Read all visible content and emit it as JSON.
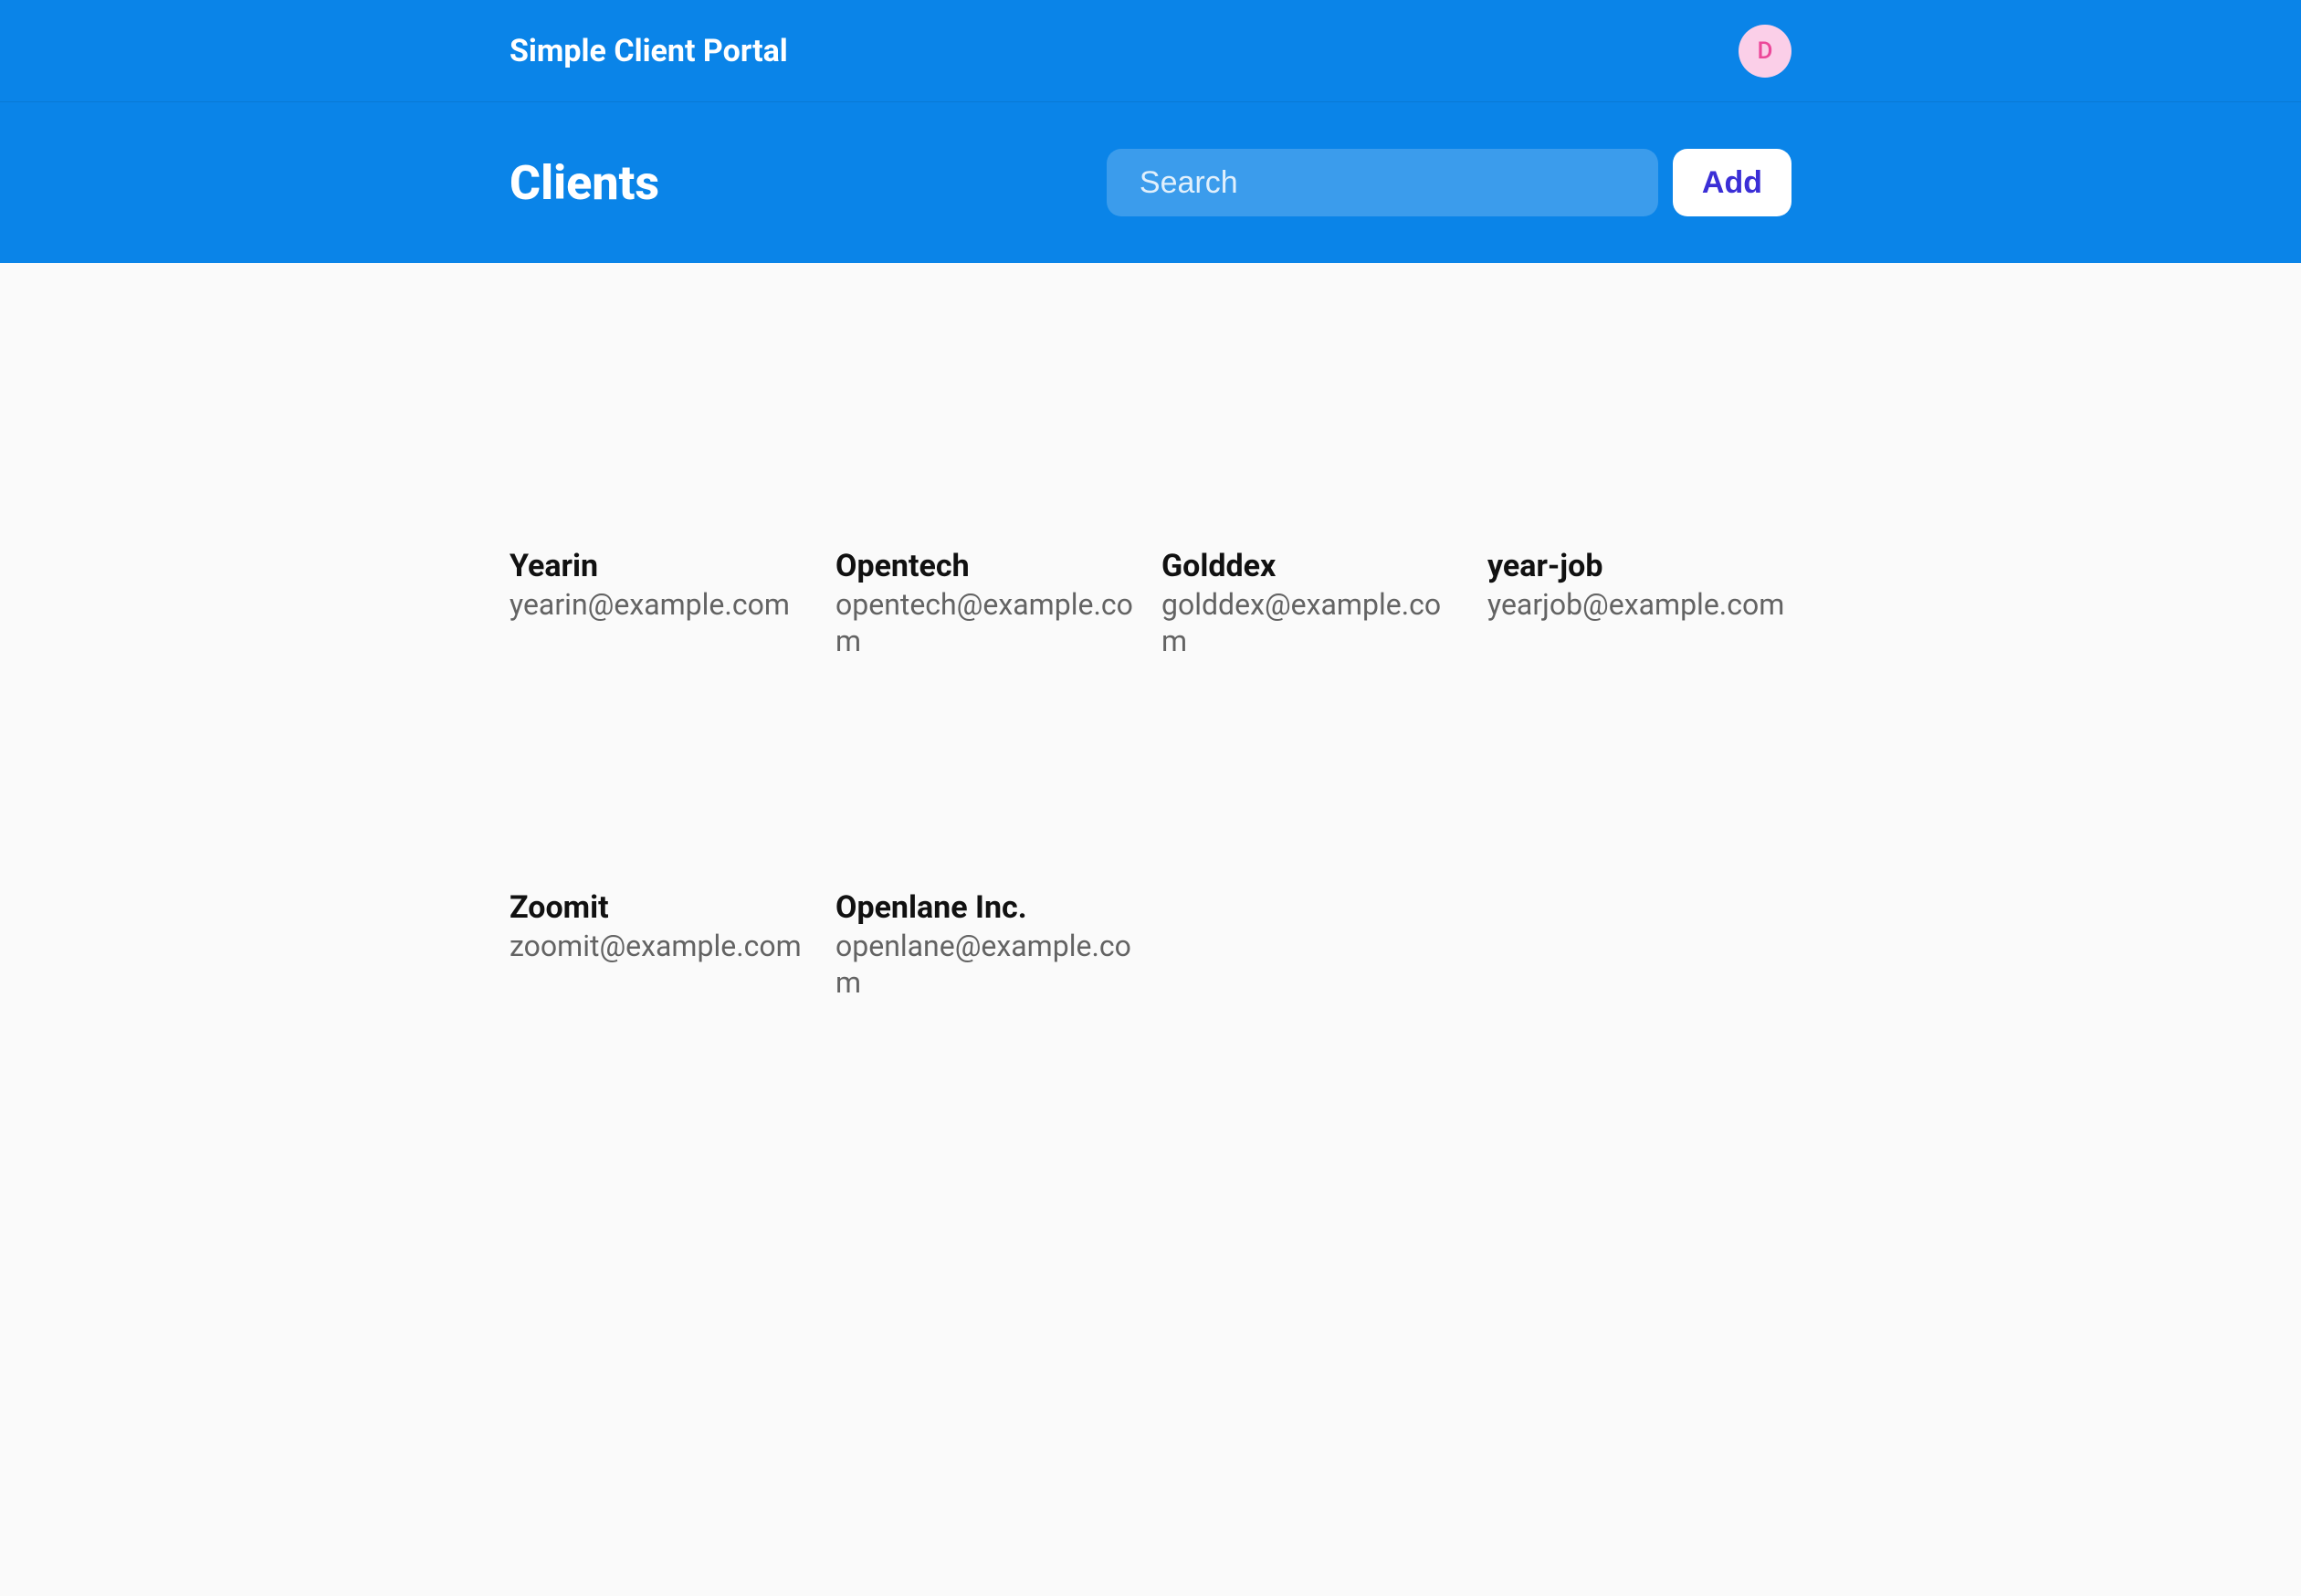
{
  "header": {
    "brand": "Simple Client Portal",
    "avatar_initial": "D"
  },
  "page": {
    "title": "Clients",
    "search_placeholder": "Search",
    "add_label": "Add"
  },
  "clients": [
    {
      "name": "Yearin",
      "email": "yearin@example.com"
    },
    {
      "name": "Opentech",
      "email": "opentech@example.com"
    },
    {
      "name": "Golddex",
      "email": "golddex@example.com"
    },
    {
      "name": "year-job",
      "email": "yearjob@example.com"
    },
    {
      "name": "Zoomit",
      "email": "zoomit@example.com"
    },
    {
      "name": "Openlane Inc.",
      "email": "openlane@example.com"
    }
  ]
}
